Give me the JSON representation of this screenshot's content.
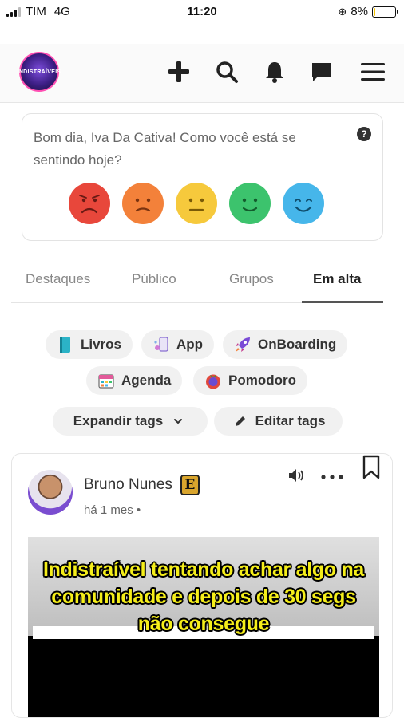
{
  "status_bar": {
    "carrier": "TIM",
    "network": "4G",
    "time": "11:20",
    "battery_percent": "8%",
    "battery_level": 0.08
  },
  "header": {
    "logo_text": "INDISTRAÍVEIS",
    "icons": [
      "plus-icon",
      "search-icon",
      "bell-icon",
      "chat-icon",
      "menu-icon"
    ]
  },
  "mood": {
    "question": "Bom dia, Iva Da Cativa! Como você está se sentindo hoje?",
    "help_label": "?",
    "faces": [
      {
        "name": "very-sad",
        "color": "#e8473b"
      },
      {
        "name": "sad",
        "color": "#f3813a"
      },
      {
        "name": "neutral",
        "color": "#f6c93c"
      },
      {
        "name": "happy",
        "color": "#3cc36d"
      },
      {
        "name": "very-happy",
        "color": "#46b6ea"
      }
    ]
  },
  "tabs": [
    {
      "label": "Destaques",
      "active": false
    },
    {
      "label": "Público",
      "active": false
    },
    {
      "label": "Grupos",
      "active": false
    },
    {
      "label": "Em alta",
      "active": true
    }
  ],
  "tags": [
    {
      "label": "Livros",
      "icon": "book-icon"
    },
    {
      "label": "App",
      "icon": "app-icon"
    },
    {
      "label": "OnBoarding",
      "icon": "rocket-icon"
    },
    {
      "label": "Agenda",
      "icon": "calendar-icon"
    },
    {
      "label": "Pomodoro",
      "icon": "tomato-icon"
    }
  ],
  "tag_actions": {
    "expand": "Expandir tags",
    "edit": "Editar tags"
  },
  "post": {
    "author": "Bruno Nunes",
    "badge": "E",
    "time": "há 1 mes",
    "separator": "•",
    "caption_lines": [
      "Indistraível tentando achar algo na",
      "comunidade e depois de 30 segs",
      "não consegue"
    ]
  },
  "colors": {
    "accent": "#555555",
    "tag_bg": "#f1f1f1",
    "caption": "#f5ee1a"
  }
}
